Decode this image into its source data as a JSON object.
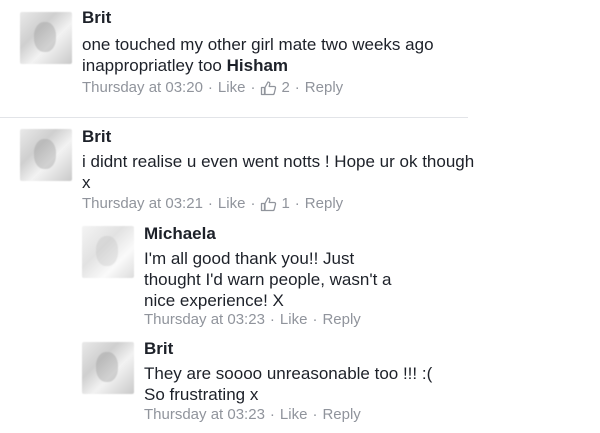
{
  "comments": [
    {
      "name": "Brit",
      "text": "one touched my other girl mate two weeks ago inappropriatley too",
      "tag": "Hisham",
      "time": "Thursday at 03:20",
      "like": "Like",
      "count": "2",
      "reply": "Reply"
    },
    {
      "name": "Brit",
      "text": "i didnt realise u even went notts ! Hope ur ok though x",
      "time": "Thursday at 03:21",
      "like": "Like",
      "count": "1",
      "reply": "Reply"
    },
    {
      "name": "Michaela",
      "text": "I'm all good thank you!! Just thought I'd warn people, wasn't a nice experience! X",
      "time": "Thursday at 03:23",
      "like": "Like",
      "reply": "Reply"
    },
    {
      "name": "Brit",
      "text": "They are soooo unreasonable too !!! :( So frustrating x",
      "time": "Thursday at 03:23",
      "like": "Like",
      "reply": "Reply"
    }
  ],
  "icons": {
    "like_count": "thumbs-up-icon"
  }
}
